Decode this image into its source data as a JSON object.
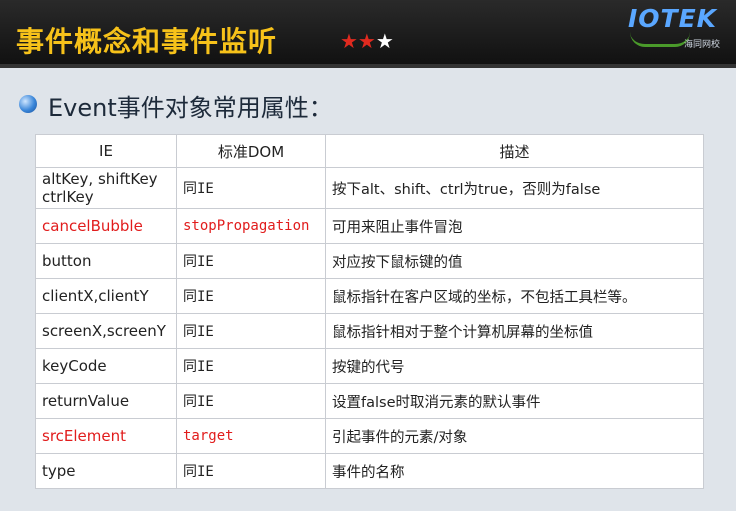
{
  "header": {
    "title": "事件概念和事件监听",
    "stars": {
      "red": "★★",
      "white": "★"
    },
    "logo": {
      "main": "IOTEK",
      "sub": "海同网校"
    }
  },
  "subtitle": "Event事件对象常用属性：",
  "table": {
    "headers": [
      "IE",
      "标准DOM",
      "描述"
    ],
    "rows": [
      {
        "ie": "altKey, shiftKey ctrlKey",
        "dom": "同IE",
        "desc": "按下alt、shift、ctrl为true，否则为false",
        "red": false
      },
      {
        "ie": "cancelBubble",
        "dom": "stopPropagation",
        "desc": "可用来阻止事件冒泡",
        "red": true
      },
      {
        "ie": "button",
        "dom": "同IE",
        "desc": "对应按下鼠标键的值",
        "red": false
      },
      {
        "ie": "clientX,clientY",
        "dom": "同IE",
        "desc": "鼠标指针在客户区域的坐标，不包括工具栏等。",
        "red": false
      },
      {
        "ie": "screenX,screenY",
        "dom": "同IE",
        "desc": "鼠标指针相对于整个计算机屏幕的坐标值",
        "red": false
      },
      {
        "ie": "keyCode",
        "dom": "同IE",
        "desc": "按键的代号",
        "red": false
      },
      {
        "ie": "returnValue",
        "dom": "同IE",
        "desc": "设置false时取消元素的默认事件",
        "red": false
      },
      {
        "ie": "srcElement",
        "dom": "target",
        "desc": "引起事件的元素/对象",
        "red": true
      },
      {
        "ie": "type",
        "dom": "同IE",
        "desc": "事件的名称",
        "red": false
      }
    ]
  }
}
